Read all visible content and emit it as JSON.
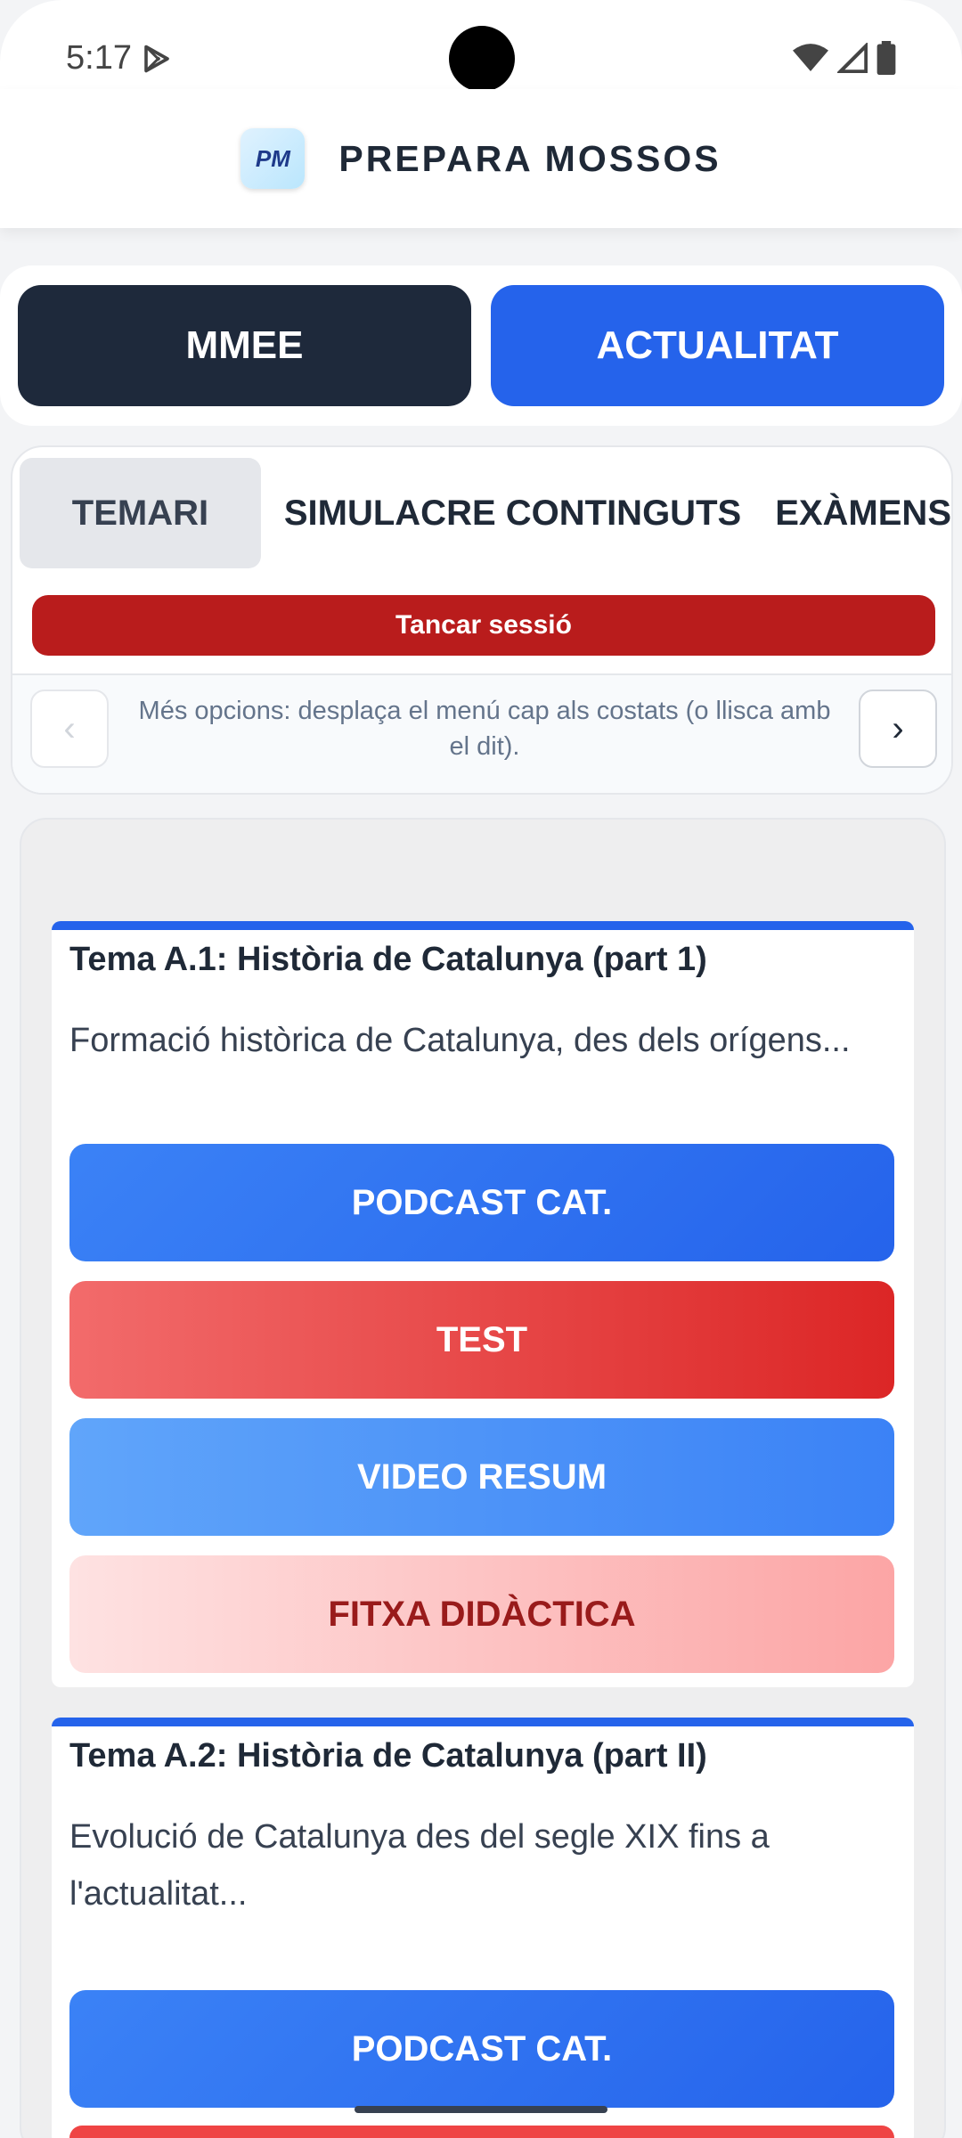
{
  "status_bar": {
    "time": "5:17"
  },
  "app": {
    "title": "PREPARA MOSSOS",
    "logo_text": "PM"
  },
  "top_tabs": [
    {
      "label": "MMEE"
    },
    {
      "label": "ACTUALITAT"
    }
  ],
  "subtabs": [
    {
      "label": "TEMARI"
    },
    {
      "label": "SIMULACRE CONTINGUTS"
    },
    {
      "label": "EXÀMENS"
    }
  ],
  "logout_label": "Tancar sessió",
  "scroll_hint": {
    "text": "Més opcions: desplaça el menú cap als costats (o llisca amb el dit).",
    "prev": "‹",
    "next": "›"
  },
  "cards": [
    {
      "title": "Tema A.1: Història de Catalunya (part 1)",
      "description": "Formació històrica de Catalunya, des dels orígens...",
      "buttons": [
        "PODCAST CAT.",
        "TEST",
        "VIDEO RESUM",
        "FITXA DIDÀCTICA"
      ]
    },
    {
      "title": "Tema A.2: Història de Catalunya (part II)",
      "description": "Evolució de Catalunya des del segle XIX fins a l'actualitat...",
      "buttons": [
        "PODCAST CAT."
      ]
    }
  ],
  "colors": {
    "primary_blue": "#2563eb",
    "dark_tab": "#1e293b",
    "logout_red": "#b91c1c"
  }
}
